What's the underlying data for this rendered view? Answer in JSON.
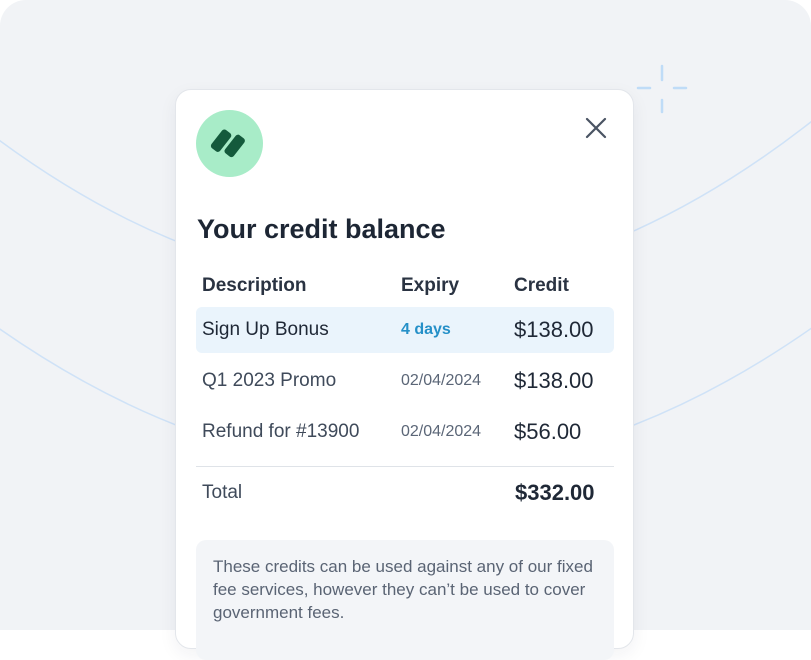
{
  "modal": {
    "title": "Your credit balance",
    "close_icon": "close-icon",
    "logo_icon": "brand-logo-icon"
  },
  "table": {
    "columns": [
      "Description",
      "Expiry",
      "Credit"
    ],
    "rows": [
      {
        "description": "Sign Up Bonus",
        "expiry": "4 days",
        "credit": "$138.00",
        "highlighted": true
      },
      {
        "description": "Q1 2023 Promo",
        "expiry": "02/04/2024",
        "credit": "$138.00",
        "highlighted": false
      },
      {
        "description": "Refund for #13900",
        "expiry": "02/04/2024",
        "credit": "$56.00",
        "highlighted": false
      }
    ],
    "total_label": "Total",
    "total_value": "$332.00"
  },
  "note": "These credits can be used against any of our fixed fee services, however they can’t be used to cover government fees.",
  "colors": {
    "brand_green": "#a8ecc8",
    "brand_dark": "#145a3c",
    "expiry_accent": "#2590c8",
    "row_highlight": "#eaf4fc",
    "background": "#f1f3f6"
  }
}
